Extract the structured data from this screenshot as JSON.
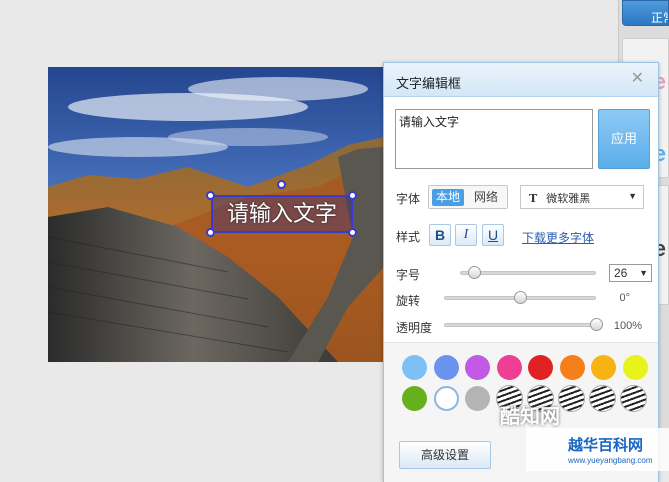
{
  "right_strip": {
    "tab_label": "正常",
    "glyphs": [
      "e",
      "e",
      "e"
    ]
  },
  "canvas": {
    "overlay_text": "请输入文字"
  },
  "dialog": {
    "title": "文字编辑框",
    "close_icon": "close-icon",
    "text_input_value": "请输入文字",
    "apply_label": "应用",
    "font_label": "字体",
    "source_local": "本地",
    "source_network": "网络",
    "font_name": "微软雅黑",
    "font_icon_glyph": "T",
    "style_label": "样式",
    "bold_label": "B",
    "italic_label": "I",
    "underline_label": "U",
    "download_fonts_link": "下载更多字体",
    "size_label": "字号",
    "size_value": "26",
    "size_slider_fraction": 0.1,
    "rotate_label": "旋转",
    "rotate_value": "0°",
    "rotate_slider_fraction": 0.5,
    "opacity_label": "透明度",
    "opacity_value": "100%",
    "opacity_slider_fraction": 1.0,
    "advanced_label": "高级设置"
  },
  "palette": {
    "row1": [
      "#7cc0f4",
      "#6a93ec",
      "#c25ae6",
      "#ef3e94",
      "#e02222",
      "#f57f19",
      "#f7b213",
      "#e8f31a"
    ],
    "row2": [
      "#66b01e",
      "#ffffff",
      "#b4b4b4"
    ],
    "selected_index_row2": 1
  },
  "watermark": {
    "text1": "酷知网",
    "text2": "越华百科网",
    "url": "www.yueyangbang.com"
  }
}
